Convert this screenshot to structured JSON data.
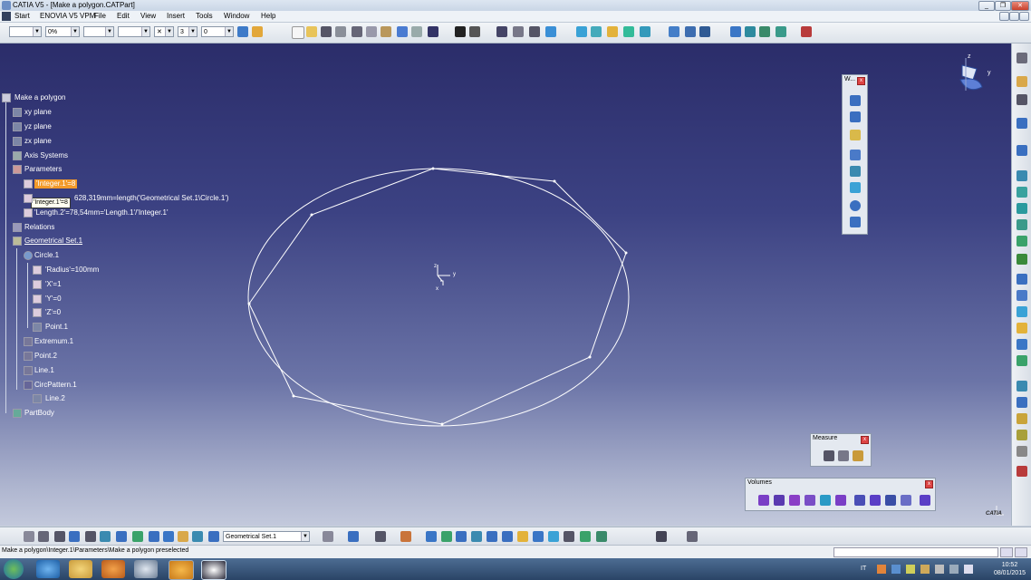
{
  "window": {
    "title": "CATIA V5 - [Make a polygon.CATPart]",
    "minimize": "_",
    "restore": "❐",
    "close": "✕"
  },
  "menu": [
    "Start",
    "ENOVIA V5 VPM",
    "File",
    "Edit",
    "View",
    "Insert",
    "Tools",
    "Window",
    "Help"
  ],
  "toolbar": {
    "transparency": "0%",
    "layer_value": "3",
    "thickness_value": "0"
  },
  "tree": {
    "root": "Make a polygon",
    "xy_plane": "xy plane",
    "yz_plane": "yz plane",
    "zx_plane": "zx plane",
    "axis_systems": "Axis Systems",
    "parameters": "Parameters",
    "integer1": "'Integer.1'=8",
    "length1": "628,319mm=length('Geometrical Set.1\\Circle.1')",
    "length2": "'Length.2'=78,54mm='Length.1'/'Integer.1'",
    "relations": "Relations",
    "geoset": "Geometrical Set.1",
    "circle": "Circle.1",
    "radius": "'Radius'=100mm",
    "x": "'X'=1",
    "y": "'Y'=0",
    "z": "'Z'=0",
    "point1": "Point.1",
    "extremum": "Extremum.1",
    "point2": "Point.2",
    "line1": "Line.1",
    "circpattern": "CircPattern.1",
    "line2": "Line.2",
    "partbody": "PartBody",
    "tooltip": "'Integer.1'=8"
  },
  "panels": {
    "wireframe_title": "W...",
    "measure_title": "Measure",
    "volumes_title": "Volumes"
  },
  "bottom": {
    "geoset_combo": "Geometrical Set.1"
  },
  "status": {
    "text": "Make a polygon\\Integer.1\\Parameters\\Make a polygon preselected"
  },
  "taskbar": {
    "time": "10:52",
    "date": "08/01/2015",
    "lang": "IT"
  },
  "viewport": {
    "compass_x": "x",
    "compass_y": "y",
    "compass_z": "z",
    "logo": "CATIA"
  },
  "colors": {
    "highlight": "#f39a2a",
    "sketch": "#ffffff"
  }
}
